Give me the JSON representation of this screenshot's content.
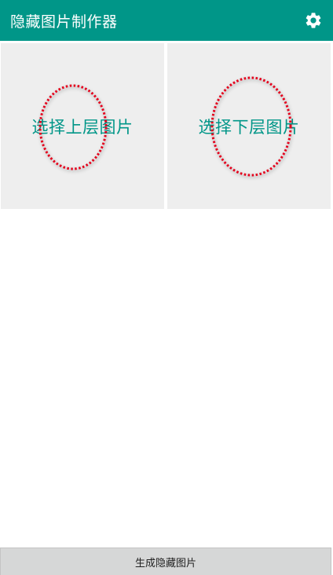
{
  "app_bar": {
    "title": "隐藏图片制作器",
    "background": "#009688",
    "settings_icon": "gear-icon"
  },
  "panels": {
    "top_layer_label": "选择上层图片",
    "bottom_layer_label": "选择下层图片",
    "label_color": "#009688",
    "panel_background": "#eeeeee"
  },
  "footer": {
    "generate_label": "生成隐藏图片"
  }
}
